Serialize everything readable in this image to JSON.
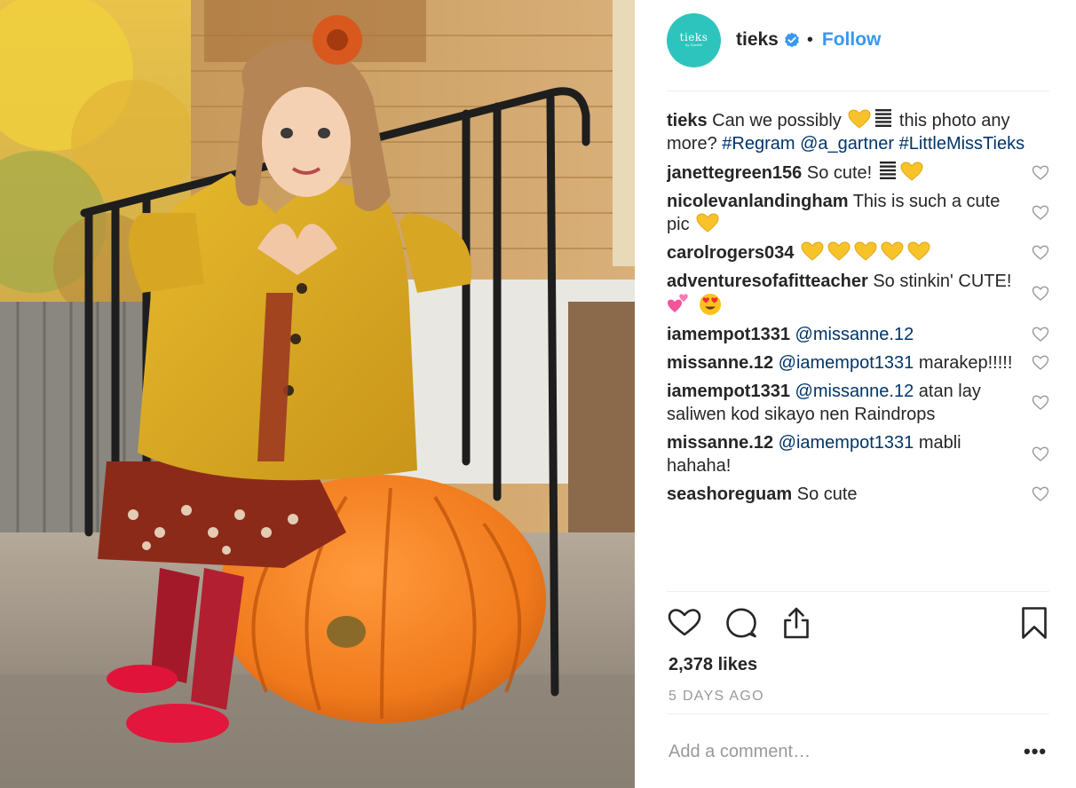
{
  "post": {
    "username": "tieks",
    "avatar_text": "tieks",
    "avatar_subtext": "by Gavrieli",
    "follow_label": "Follow",
    "separator": "•"
  },
  "caption": {
    "username": "tieks",
    "text_before": "Can we possibly",
    "text_after": "this photo any more?",
    "hashtag_regram": "#Regram",
    "mention": "@a_gartner",
    "hashtag_little": "#LittleMissTieks"
  },
  "comments": [
    {
      "username": "janettegreen156",
      "text": "So cute!"
    },
    {
      "username": "nicolevanlandingham",
      "text": "This is such a cute pic"
    },
    {
      "username": "carolrogers034",
      "text": ""
    },
    {
      "username": "adventuresofafitteacher",
      "text": "So stinkin' CUTE!"
    },
    {
      "username": "iamempot1331",
      "mention": "@missanne.12",
      "text": ""
    },
    {
      "username": "missanne.12",
      "mention": "@iamempot1331",
      "text": "marakep!!!!!"
    },
    {
      "username": "iamempot1331",
      "mention": "@missanne.12",
      "text": "atan lay saliwen kod sikayo nen Raindrops"
    },
    {
      "username": "missanne.12",
      "mention": "@iamempot1331",
      "text": "mabli hahaha!"
    },
    {
      "username": "seashoreguam",
      "text": "So cute"
    }
  ],
  "likes": "2,378 likes",
  "time_ago": "5 DAYS AGO",
  "add_comment_placeholder": "Add a comment…",
  "more_label": "•••",
  "icons": {
    "like": "heart-outline-icon",
    "comment": "comment-bubble-icon",
    "share": "share-upload-icon",
    "save": "bookmark-icon",
    "verified": "verified-badge-icon"
  },
  "colors": {
    "link": "#003569",
    "follow": "#3897f0",
    "avatar": "#2ec4be",
    "muted": "#999999"
  }
}
